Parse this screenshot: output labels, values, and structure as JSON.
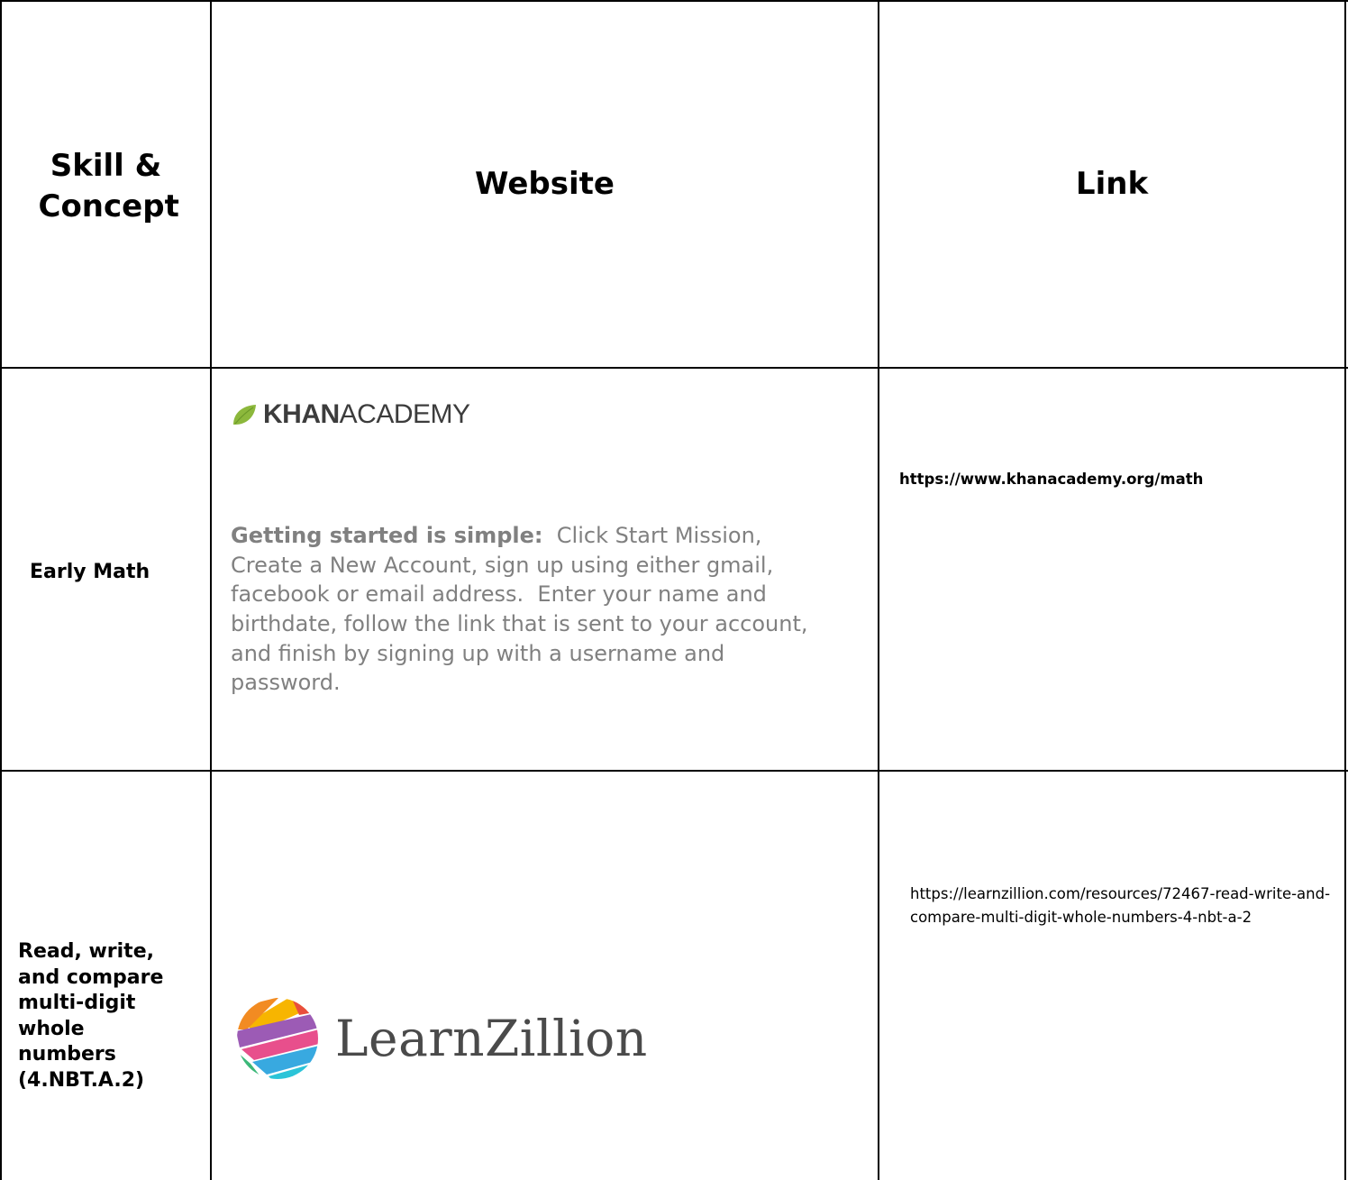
{
  "table": {
    "headers": {
      "skill": "Skill & Concept",
      "website": "Website",
      "link": "Link"
    },
    "rows": [
      {
        "skill": "Early Math",
        "website": {
          "logo_text_bold": "KHAN",
          "logo_text_light": "ACADEMY",
          "logo_icon": "leaf-icon",
          "instructions_lead": "Getting started is simple:",
          "instructions_body": "  Click Start Mission, Create a New Account, sign up using either gmail, facebook or email address.  Enter your name and birthdate, follow the link that is sent to your account, and finish by signing up with a username and password."
        },
        "link": "https://www.khanacademy.org/math"
      },
      {
        "skill": "Read, write, and compare multi-digit whole numbers (4.NBT.A.2)",
        "website": {
          "logo_text": "LearnZillion",
          "logo_icon": "learnzillion-circle-icon"
        },
        "link": "https://learnzillion.com/resources/72467-read-write-and-compare-multi-digit-whole-numbers-4-nbt-a-2"
      }
    ]
  },
  "colors": {
    "border": "#000000",
    "instructions_text": "#808080",
    "khan_leaf": "#8cb83c",
    "logo_text": "#3c3c3c"
  }
}
